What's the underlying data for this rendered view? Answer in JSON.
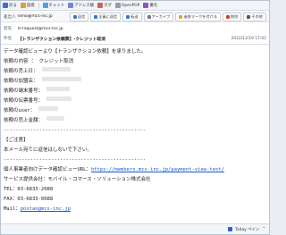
{
  "toolbar": {
    "items": [
      {
        "label": "戻る",
        "icon": "back-icon",
        "color": "#3c74c9"
      },
      {
        "label": "迷惑",
        "icon": "spam-icon",
        "color": "#d8a33a"
      },
      {
        "label": "チャット",
        "icon": "chat-icon",
        "color": "#4aa3e0"
      },
      {
        "label": "アドレス帳",
        "icon": "address-book-icon",
        "color": "#6b8ad6"
      },
      {
        "label": "タグ",
        "icon": "tag-icon",
        "color": "#d35f5f"
      },
      {
        "label": "OpenPGP",
        "icon": "key-icon",
        "color": "#9c9c9c"
      },
      {
        "label": "署名",
        "icon": "signature-icon",
        "color": "#8b5ab8"
      }
    ]
  },
  "header": {
    "from_label": "差出人",
    "from_value": "seno@mcs-inc.jp",
    "to_label": "宛先",
    "to_value": "tr-request@mcs-inc.jp",
    "subject_label": "件名",
    "subject_value": "【トランザクション依頼票】-クレジット取消",
    "date": "2022/12/19 17:02",
    "actions": [
      {
        "label": "返信",
        "icon": "reply-icon",
        "color": "#3c74c9"
      },
      {
        "label": "全員に返信",
        "icon": "reply-all-icon",
        "color": "#3c74c9"
      },
      {
        "label": "転送",
        "icon": "forward-icon",
        "color": "#3c74c9"
      },
      {
        "label": "アーカイブ",
        "icon": "archive-icon",
        "color": "#6d7b8c"
      },
      {
        "label": "迷惑マークを付ける",
        "icon": "junk-icon",
        "color": "#d8a33a"
      },
      {
        "label": "削除",
        "icon": "delete-icon",
        "color": "#c2452d"
      },
      {
        "label": "その他",
        "icon": "more-icon",
        "color": "#555555"
      }
    ]
  },
  "body": {
    "intro": "データ確認ビューより【トランザクション依頼】を承りました。",
    "fields": [
      {
        "key": "依頼の内容",
        "sep": " ： ",
        "value": "クレジット取消"
      },
      {
        "key": "依頼の売上日",
        "sep": "：",
        "value": ""
      },
      {
        "key": "依頼の加盟店",
        "sep": "：",
        "value": ""
      },
      {
        "key": "依頼の端末番号",
        "sep": "：",
        "value": ""
      },
      {
        "key": "依頼の伝票番号",
        "sep": "：",
        "value": ""
      },
      {
        "key": "依頼のuser",
        "sep": "：",
        "value": ""
      },
      {
        "key": "依頼の売上金額",
        "sep": "：",
        "value": ""
      }
    ],
    "rule": "------------------------------------------------",
    "notice_title": "【ご注意】",
    "notice_text": "本メール宛てに返信はしないで下さい。",
    "rule2": "------------------------------------------------",
    "footer_url_label": "個人事業者向けデータ確認ビューURL：",
    "footer_url": "https://members.mcs-inc.jp/payment-view-test/",
    "company": "サービス提供会社：モバイル・コマース・ソリューション株式会社",
    "tel": "TEL：03-6833-2088",
    "fax": "FAX：03-6833-0088",
    "mail_label": "Mail：",
    "mail": "postan@mcs-inc.jp"
  },
  "status": {
    "label": "Today ペイン"
  }
}
